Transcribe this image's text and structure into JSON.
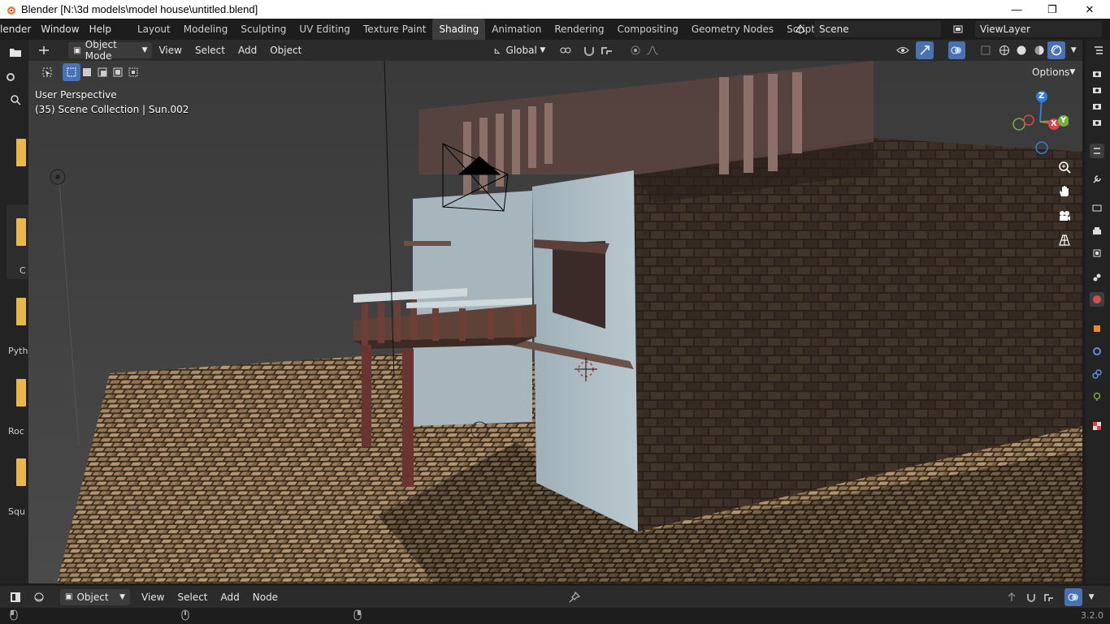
{
  "window": {
    "title": "Blender [N:\\3d models\\model house\\untitled.blend]",
    "minimize": "—",
    "maximize": "❐",
    "close": "✕"
  },
  "menus": [
    "lender",
    "Window",
    "Help"
  ],
  "workspaces": [
    {
      "label": "Layout",
      "active": false
    },
    {
      "label": "Modeling",
      "active": false
    },
    {
      "label": "Sculpting",
      "active": false
    },
    {
      "label": "UV Editing",
      "active": false
    },
    {
      "label": "Texture Paint",
      "active": false
    },
    {
      "label": "Shading",
      "active": true
    },
    {
      "label": "Animation",
      "active": false
    },
    {
      "label": "Rendering",
      "active": false
    },
    {
      "label": "Compositing",
      "active": false
    },
    {
      "label": "Geometry Nodes",
      "active": false
    },
    {
      "label": "Scripting",
      "active": false
    }
  ],
  "add_workspace": "+",
  "scene": {
    "value": "Scene"
  },
  "view_layer": {
    "value": "ViewLayer"
  },
  "viewport_header": {
    "mode": "Object Mode",
    "view": "View",
    "select": "Select",
    "add": "Add",
    "object": "Object",
    "orientation": "Global",
    "options": "Options"
  },
  "viewport_overlay": {
    "perspective": "User Perspective",
    "collection": "(35) Scene Collection | Sun.002"
  },
  "gizmo": {
    "x": "X",
    "y": "Y",
    "z": "Z"
  },
  "file_browser_items": [
    {
      "label": "C"
    },
    {
      "label": "Pyth"
    },
    {
      "label": "Roc"
    },
    {
      "label": "Squ"
    }
  ],
  "node_editor_header": {
    "type": "Object",
    "view": "View",
    "select": "Select",
    "add": "Add",
    "node": "Node"
  },
  "status": {
    "version": "3.2.0"
  },
  "colors": {
    "accent_blue": "#4772b3",
    "active_tab": "#3d3d3d",
    "background": "#1d1d1d",
    "header": "#2b2b2b",
    "axis_x": "#e2434b",
    "axis_y": "#6fb13b",
    "axis_z": "#2f7fd8"
  }
}
